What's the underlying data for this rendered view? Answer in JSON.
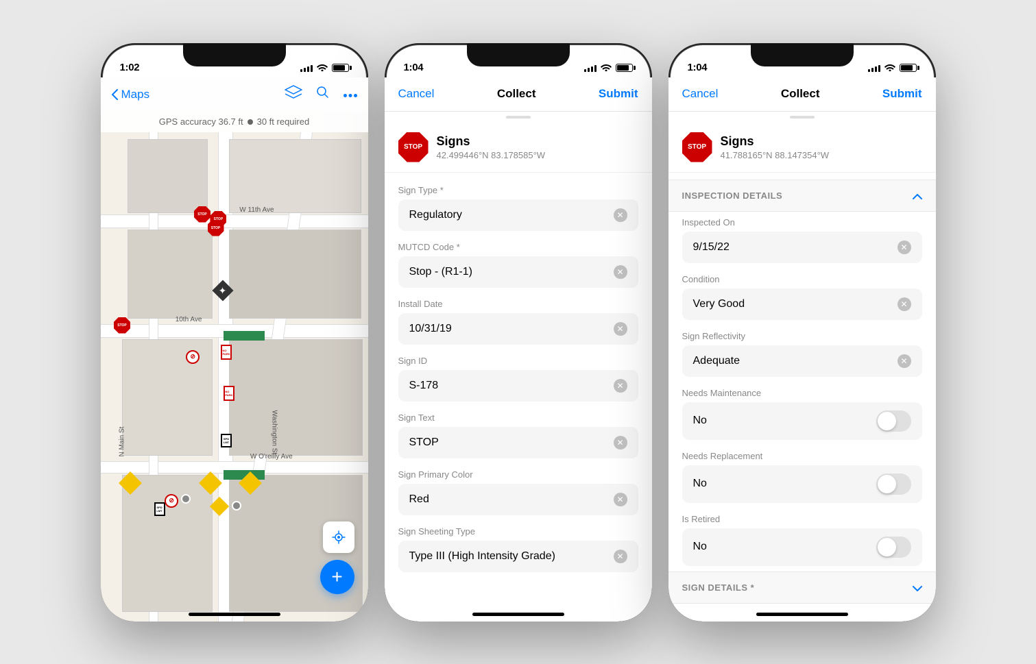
{
  "phone1": {
    "status": {
      "time": "1:02",
      "signal": [
        3,
        5,
        7,
        9,
        11
      ],
      "wifi": "wifi",
      "battery": "battery"
    },
    "nav": {
      "back_label": "Maps",
      "layers_icon": "layers-icon",
      "search_icon": "search-icon",
      "more_icon": "more-icon"
    },
    "gps_bar": {
      "text1": "GPS accuracy 36.7 ft",
      "dot": "·",
      "text2": "30 ft required"
    },
    "fab_label": "+",
    "streets": {
      "w11th": "W 11th Ave",
      "w10th": "10th Ave",
      "n_main": "N Main St",
      "washington": "Washington St",
      "w_oreilly": "W O'reilly Ave"
    }
  },
  "phone2": {
    "status": {
      "time": "1:04",
      "location_arrow": "▶"
    },
    "nav": {
      "cancel_label": "Cancel",
      "title": "Collect",
      "submit_label": "Submit"
    },
    "feature": {
      "icon_text": "STOP",
      "name": "Signs",
      "coords": "42.499446°N  83.178585°W"
    },
    "fields": [
      {
        "label": "Sign Type *",
        "value": "Regulatory"
      },
      {
        "label": "MUTCD Code *",
        "value": "Stop - (R1-1)"
      },
      {
        "label": "Install Date",
        "value": "10/31/19"
      },
      {
        "label": "Sign ID",
        "value": "S-178"
      },
      {
        "label": "Sign Text",
        "value": "STOP"
      },
      {
        "label": "Sign Primary Color",
        "value": "Red"
      },
      {
        "label": "Sign Sheeting Type",
        "value": "Type III (High Intensity Grade)"
      }
    ]
  },
  "phone3": {
    "status": {
      "time": "1:04"
    },
    "nav": {
      "cancel_label": "Cancel",
      "title": "Collect",
      "submit_label": "Submit"
    },
    "feature": {
      "icon_text": "STOP",
      "name": "Signs",
      "coords": "41.788165°N  88.147354°W"
    },
    "section_inspection": {
      "label": "INSPECTION DETAILS",
      "expanded": true
    },
    "inspection_fields": [
      {
        "label": "Inspected On",
        "value": "9/15/22",
        "type": "input"
      },
      {
        "label": "Condition",
        "value": "Very Good",
        "type": "input"
      },
      {
        "label": "Sign Reflectivity",
        "value": "Adequate",
        "type": "input"
      },
      {
        "label": "Needs Maintenance",
        "value": "No",
        "type": "toggle"
      },
      {
        "label": "Needs Replacement",
        "value": "No",
        "type": "toggle"
      },
      {
        "label": "Is Retired",
        "value": "No",
        "type": "toggle"
      }
    ],
    "section_sign": {
      "label": "SIGN DETAILS *",
      "collapsed": true
    }
  },
  "colors": {
    "accent": "#007aff",
    "stop_red": "#cc0000",
    "bg_light": "#f5f5f5",
    "text_secondary": "#888888",
    "section_bg": "#f8f8f8"
  }
}
